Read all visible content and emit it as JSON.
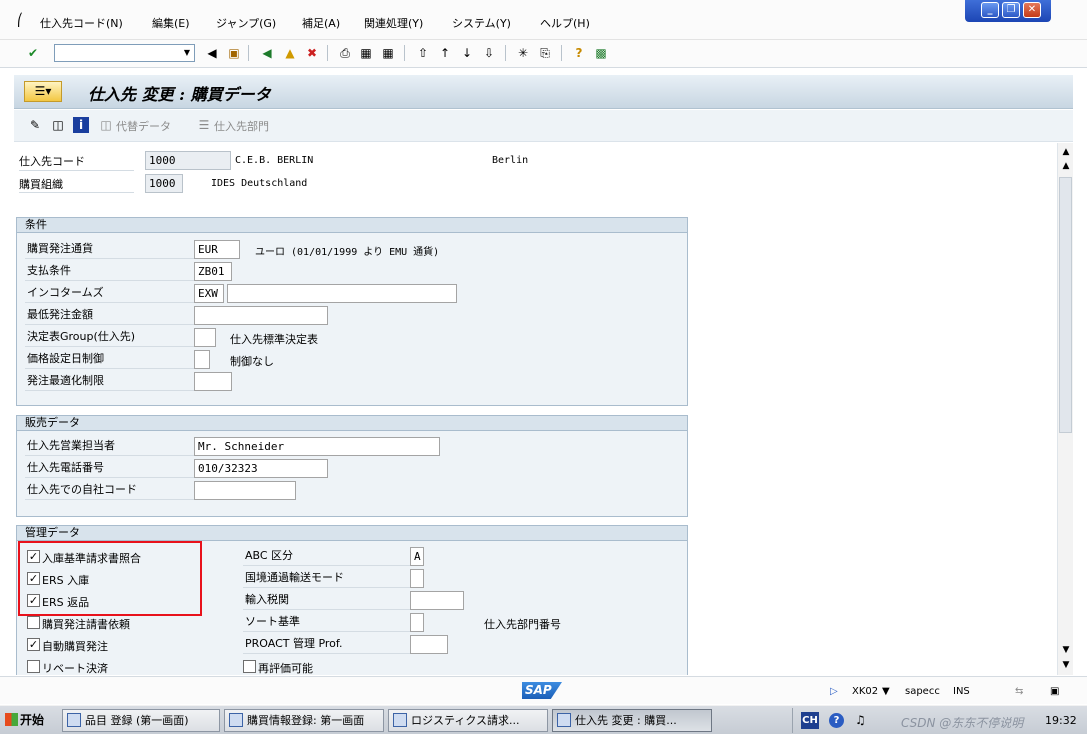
{
  "menu": {
    "items": [
      "仕入先コード(N)",
      "編集(E)",
      "ジャンプ(G)",
      "補足(A)",
      "関連処理(Y)",
      "システム(Y)",
      "ヘルプ(H)"
    ]
  },
  "colors": {
    "accent": "#2f60c4",
    "highlight": "#e8111b"
  },
  "title": "仕入先 変更 : 購買データ",
  "app_toolbar": {
    "alt_data": "代替データ",
    "vendor_dept": "仕入先部門"
  },
  "header": {
    "vendor_label": "仕入先コード",
    "vendor_code": "1000",
    "vendor_name": "C.E.B. BERLIN",
    "vendor_city": "Berlin",
    "purch_org_label": "購買組織",
    "purch_org": "1000",
    "purch_org_name": "IDES Deutschland"
  },
  "conditions": {
    "title": "条件",
    "currency_label": "購買発注通貨",
    "currency": "EUR",
    "currency_desc": "ユーロ (01/01/1999 より EMU 通貨)",
    "payment_label": "支払条件",
    "payment": "ZB01",
    "incoterms_label": "インコタームズ",
    "incoterms": "EXW",
    "incoterms2": "",
    "min_order_label": "最低発注金額",
    "min_order": "",
    "schema_label": "決定表Group(仕入先)",
    "schema": "",
    "schema_desc": "仕入先標準決定表",
    "pricing_label": "価格設定日制御",
    "pricing": "",
    "pricing_desc": "制御なし",
    "opt_label": "発注最適化制限",
    "opt": ""
  },
  "sales": {
    "title": "販売データ",
    "salesperson_label": "仕入先営業担当者",
    "salesperson": "Mr. Schneider",
    "phone_label": "仕入先電話番号",
    "phone": "010/32323",
    "acct_label": "仕入先での自社コード",
    "acct": ""
  },
  "control": {
    "title": "管理データ",
    "gr_iv": {
      "label": "入庫基準請求書照合",
      "checked": true
    },
    "ers_gr": {
      "label": "ERS 入庫",
      "checked": true
    },
    "ers_ret": {
      "label": "ERS 返品",
      "checked": true
    },
    "inv_req": {
      "label": "購買発注請書依頼",
      "checked": false
    },
    "auto_po": {
      "label": "自動購買発注",
      "checked": true
    },
    "rebate": {
      "label": "リベート決済",
      "checked": false
    },
    "abc_label": "ABC 区分",
    "abc": "A",
    "transport_label": "国境通過輸送モード",
    "transport": "",
    "customs_label": "輸入税関",
    "customs": "",
    "sort_label": "ソート基準",
    "sort": "",
    "dept_label": "仕入先部門番号",
    "proact_label": "PROACT 管理 Prof.",
    "proact": "",
    "reval": {
      "label": "再評価可能",
      "checked": false
    }
  },
  "status": {
    "tcode": "XK02",
    "server": "sapecc",
    "mode": "INS"
  },
  "taskbar": {
    "start": "开始",
    "tasks": [
      "品目 登録 (第一画面)",
      "購買情報登録: 第一画面",
      "ロジスティクス請求...",
      "仕入先 変更 : 購買..."
    ],
    "lang": "CH",
    "watermark": "CSDN @东东不停说明",
    "clock": "19:32"
  }
}
